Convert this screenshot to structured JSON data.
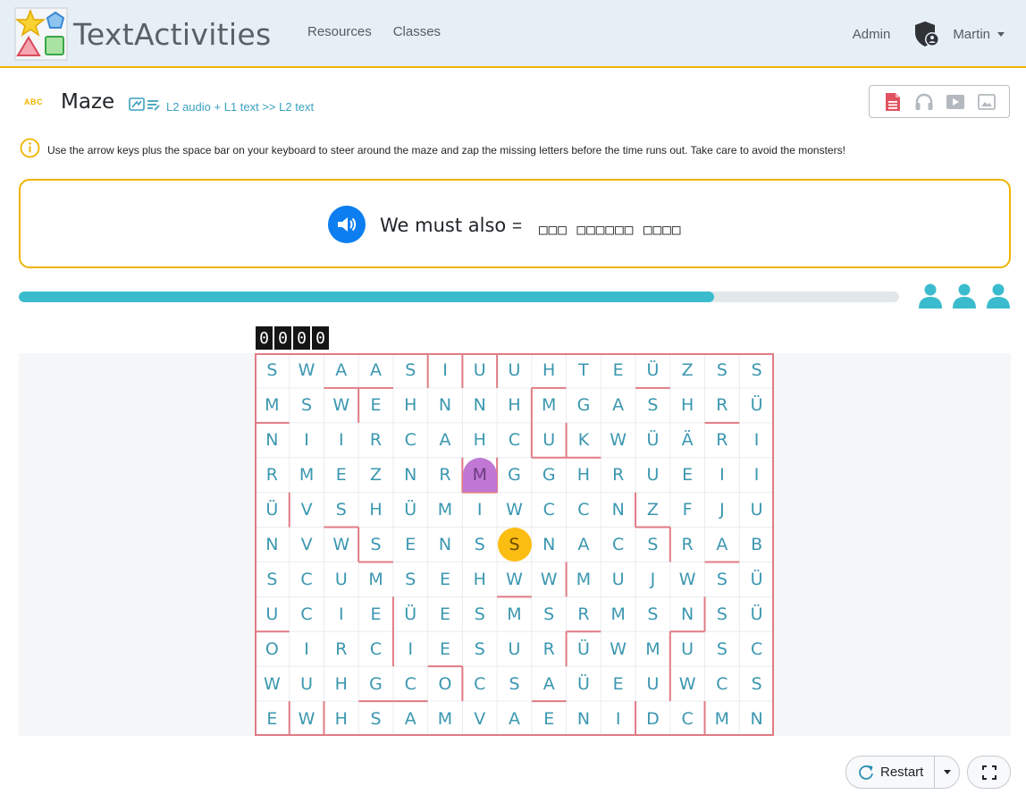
{
  "navbar": {
    "brand": "TextActivities",
    "links": [
      "Resources",
      "Classes"
    ],
    "admin": "Admin",
    "user": "Martin"
  },
  "header": {
    "abc_label": "ABC",
    "title": "Maze",
    "mode": "L2 audio + L1 text >> L2 text",
    "media_buttons": [
      "text-icon",
      "headphones-icon",
      "video-icon",
      "image-icon"
    ]
  },
  "instruction": "Use the arrow keys plus the space bar on your keyboard to steer around the maze and zap the missing letters before the time runs out. Take care to avoid the monsters!",
  "prompt": {
    "source_text": "We must also",
    "equals": "=",
    "target_masked": "□□□ □□□□□□ □□□□"
  },
  "progress": {
    "fraction": 0.79
  },
  "lives": 3,
  "score": [
    "0",
    "0",
    "0",
    "0"
  ],
  "maze": {
    "rows": [
      "SWAASIUUHTEÜZSS",
      "MSWEHNNHMGASHRÜ",
      "NIIRCAHCUKWÜÄRI",
      "RMEZNRMGGHRUEII",
      "ÜVSHÜMIWCCNZFJU",
      "NVWSENSSNACSRAB",
      "SCUMSEHWWMUJWSÜ",
      "UCIEÜESMSRMSNSÜ",
      "OIRCIESURÜWMUSC",
      "WUHGCOCSAÜEUWCS",
      "EWHSAMVAENIDCMN"
    ],
    "player": {
      "row": 5,
      "col": 7,
      "letter": "S"
    },
    "monster": {
      "row": 3,
      "col": 6,
      "letter": "M"
    }
  },
  "controls": {
    "restart": "Restart"
  },
  "colors": {
    "accent": "#f0b400",
    "teal": "#3bbcce",
    "letter": "#3b97b0",
    "wall": "#e07b85",
    "player": "#fbbd12",
    "monster": "#c078d4"
  }
}
